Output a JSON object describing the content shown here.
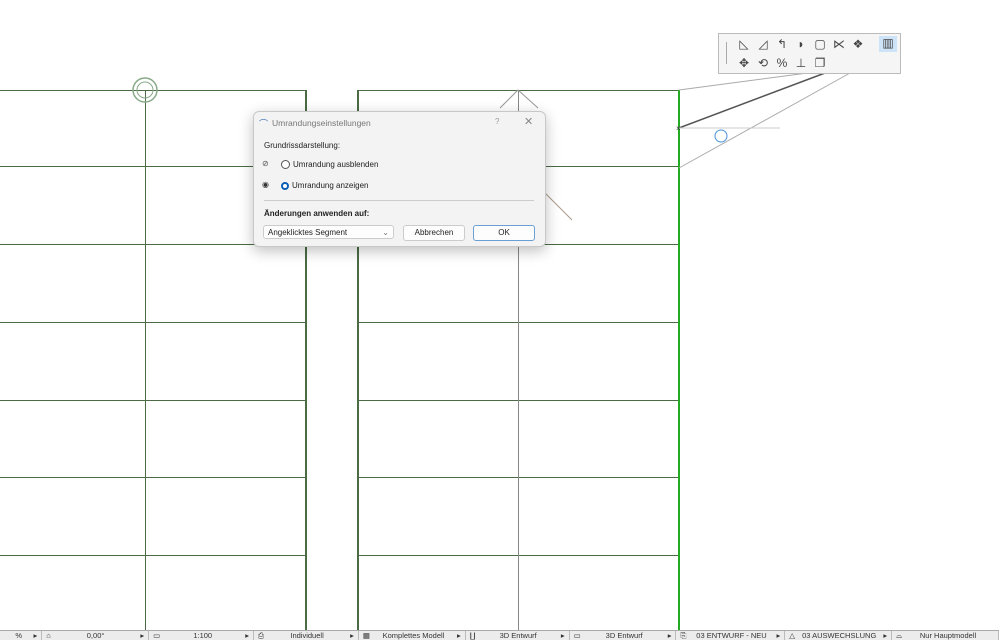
{
  "dialog": {
    "title": "Umrandungseinstellungen",
    "help": "?",
    "close": "✕",
    "section": "Grundrissdarstellung:",
    "option_hide": "Umrandung ausblenden",
    "option_show": "Umrandung anzeigen",
    "selected": "show",
    "apply_label": "Änderungen anwenden auf:",
    "apply_value": "Angeklicktes Segment",
    "cancel": "Abbrechen",
    "ok": "OK"
  },
  "toolbar": {
    "icons": [
      "insert-vertex",
      "curve-edge",
      "tangent-edge",
      "fillet",
      "chamfer",
      "offset-edge",
      "offset-all",
      "visibility-toggle",
      "move",
      "rotate",
      "mirror",
      "elevate",
      "duplicate"
    ]
  },
  "status": [
    "%",
    "0,00°",
    "1:100",
    "Individuell",
    "Komplettes Modell",
    "3D Entwurf",
    "3D Entwurf",
    "03 ENTWURF - NEU",
    "03 AUSWECHSLUNG",
    "Nur Hauptmodell"
  ],
  "colors": {
    "grid": "#4a6b44",
    "selected": "#22aa22",
    "accent": "#0a5fb4"
  }
}
